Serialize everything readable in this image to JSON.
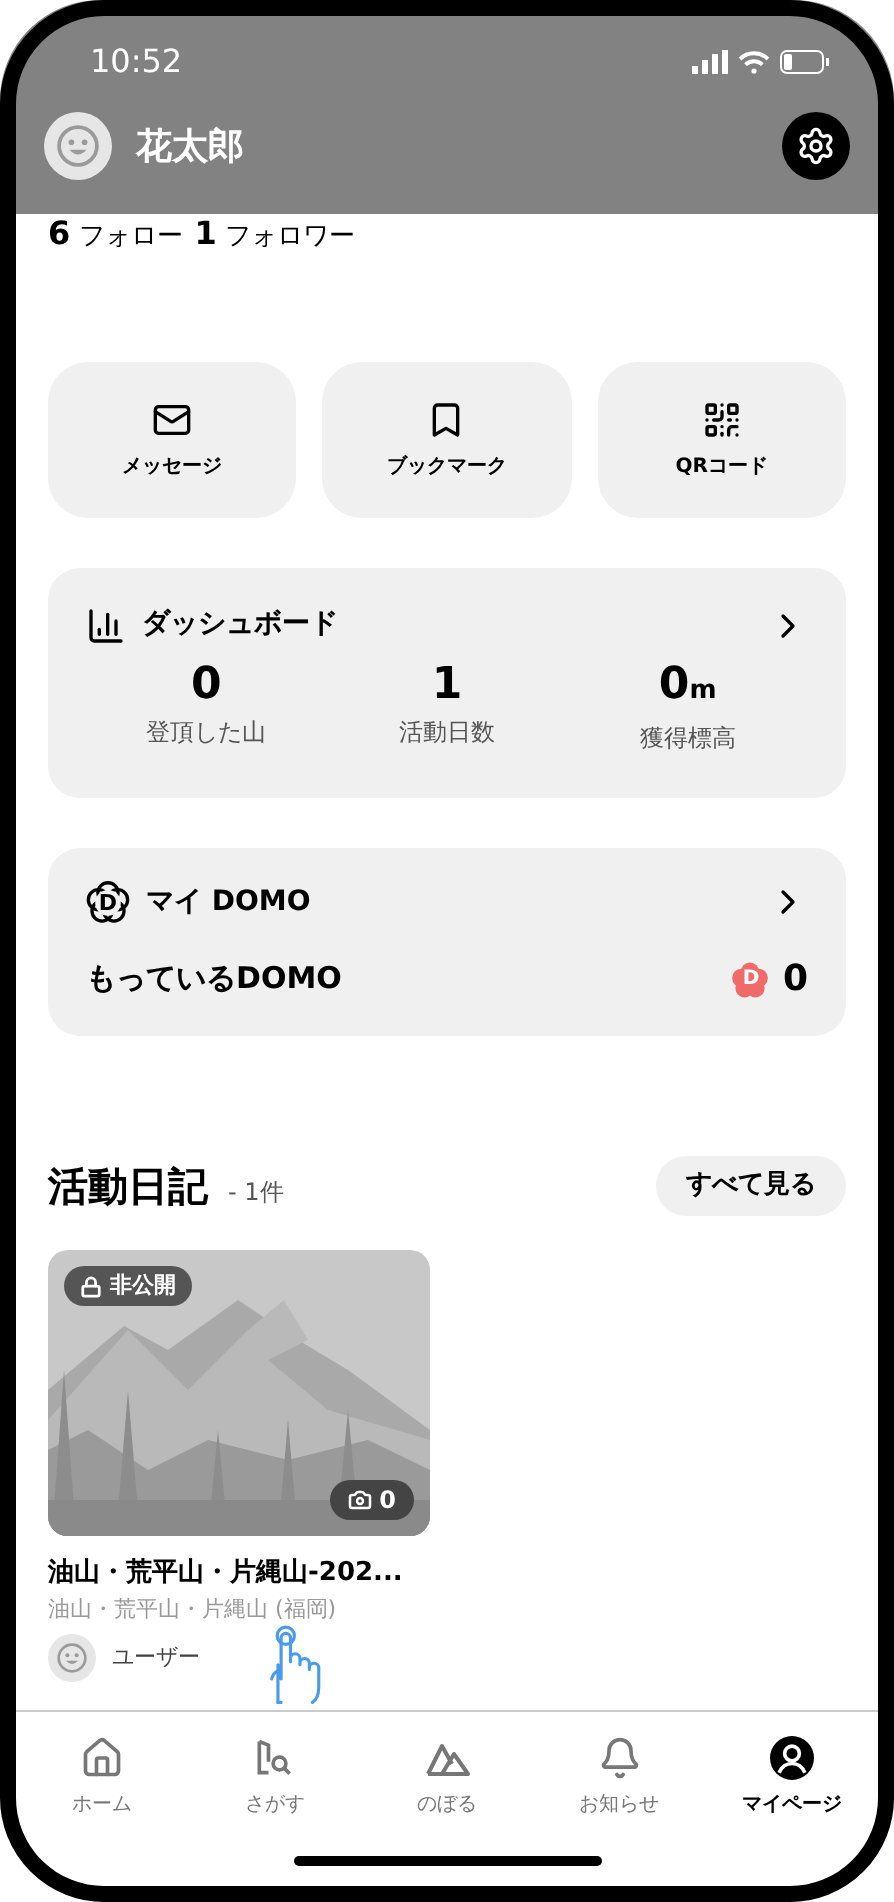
{
  "status_bar": {
    "time": "10:52"
  },
  "profile": {
    "name": "花太郎",
    "follow_count": "6",
    "follow_label": "フォロー",
    "follower_count": "1",
    "follower_label": "フォロワー"
  },
  "quick_actions": [
    {
      "kind": "mail",
      "label": "メッセージ"
    },
    {
      "kind": "bookmark",
      "label": "ブックマーク"
    },
    {
      "kind": "qr",
      "label": "QRコード"
    }
  ],
  "dashboard": {
    "title": "ダッシュボード",
    "stats": [
      {
        "value": "0",
        "label": "登頂した山"
      },
      {
        "value": "1",
        "label": "活動日数"
      },
      {
        "value": "0",
        "unit": "m",
        "label": "獲得標高"
      }
    ]
  },
  "domo": {
    "title_icon_letter": "D",
    "title": "マイ DOMO",
    "owned_label": "もっているDOMO",
    "count_icon_letter": "D",
    "owned_count": "0"
  },
  "diary": {
    "title": "活動日記",
    "count": "- 1件",
    "see_all": "すべて見る",
    "entries": [
      {
        "privacy": "非公開",
        "photo_count": "0",
        "title": "油山・荒平山・片縄山-202...",
        "subtitle": "油山・荒平山・片縄山 (福岡)",
        "user": "ユーザー"
      }
    ]
  },
  "tab_bar": [
    {
      "kind": "home",
      "label": "ホーム",
      "selected": false
    },
    {
      "kind": "search",
      "label": "さがす",
      "selected": false
    },
    {
      "kind": "climb",
      "label": "のぼる",
      "selected": false
    },
    {
      "kind": "notice",
      "label": "お知らせ",
      "selected": false
    },
    {
      "kind": "mypage",
      "label": "マイページ",
      "selected": true
    }
  ]
}
